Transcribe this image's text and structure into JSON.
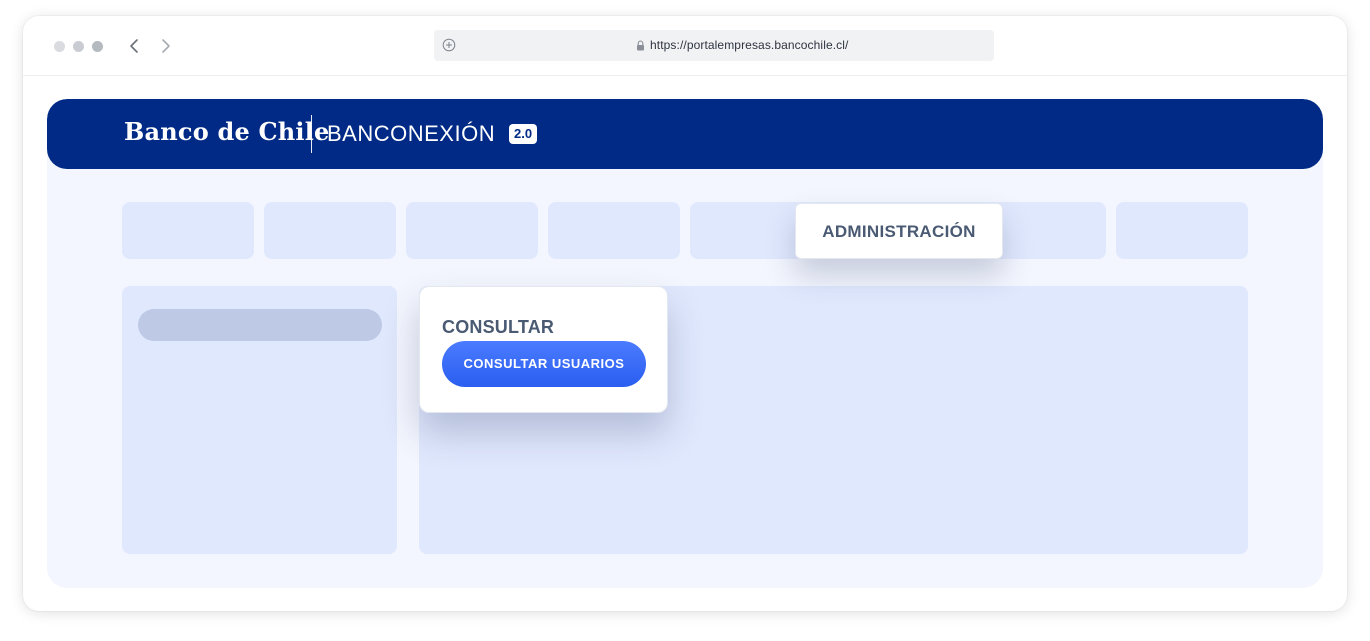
{
  "browser": {
    "url": "https://portalempresas.bancochile.cl/",
    "icons": [
      "window-dot-icon",
      "back-arrow-icon",
      "forward-arrow-icon",
      "new-tab-plus-icon",
      "lock-icon"
    ]
  },
  "header": {
    "brand": "Banco de Chile",
    "product": "BANCONEXIÓN",
    "version": "2.0",
    "background_color": "#002a85"
  },
  "menu": {
    "highlighted_item": "ADMINISTRACIÓN"
  },
  "submenu": {
    "section_title": "CONSULTAR",
    "action_button": "CONSULTAR USUARIOS",
    "button_color": "#3a6bfb"
  }
}
